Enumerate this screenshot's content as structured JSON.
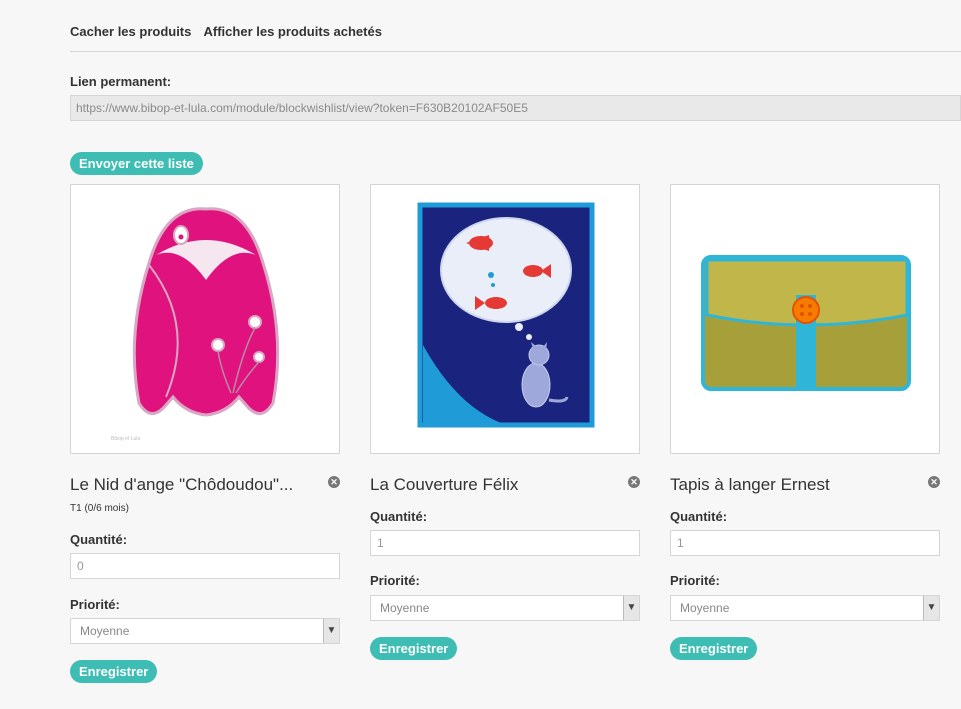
{
  "top_links": {
    "hide_products": "Cacher les produits",
    "show_bought": "Afficher les produits achetés"
  },
  "permalink": {
    "label": "Lien permanent:",
    "value": "https://www.bibop-et-lula.com/module/blockwishlist/view?token=F630B20102AF50E5"
  },
  "send_button": "Envoyer cette liste",
  "colors": {
    "accent": "#3dbdb3"
  },
  "icons": {
    "remove": "remove-circle-icon",
    "dropdown": "chevron-down-icon"
  },
  "products": [
    {
      "name": "Le Nid d'ange \"Chôdoudou\"...",
      "attribute": "T1 (0/6 mois)",
      "qty_label": "Quantité:",
      "qty_value": "0",
      "priority_label": "Priorité:",
      "priority_value": "Moyenne",
      "save_label": "Enregistrer",
      "image_caption": "Bibop et Lula"
    },
    {
      "name": "La Couverture Félix",
      "qty_label": "Quantité:",
      "qty_value": "1",
      "priority_label": "Priorité:",
      "priority_value": "Moyenne",
      "save_label": "Enregistrer"
    },
    {
      "name": "Tapis à langer Ernest",
      "qty_label": "Quantité:",
      "qty_value": "1",
      "priority_label": "Priorité:",
      "priority_value": "Moyenne",
      "save_label": "Enregistrer"
    }
  ]
}
